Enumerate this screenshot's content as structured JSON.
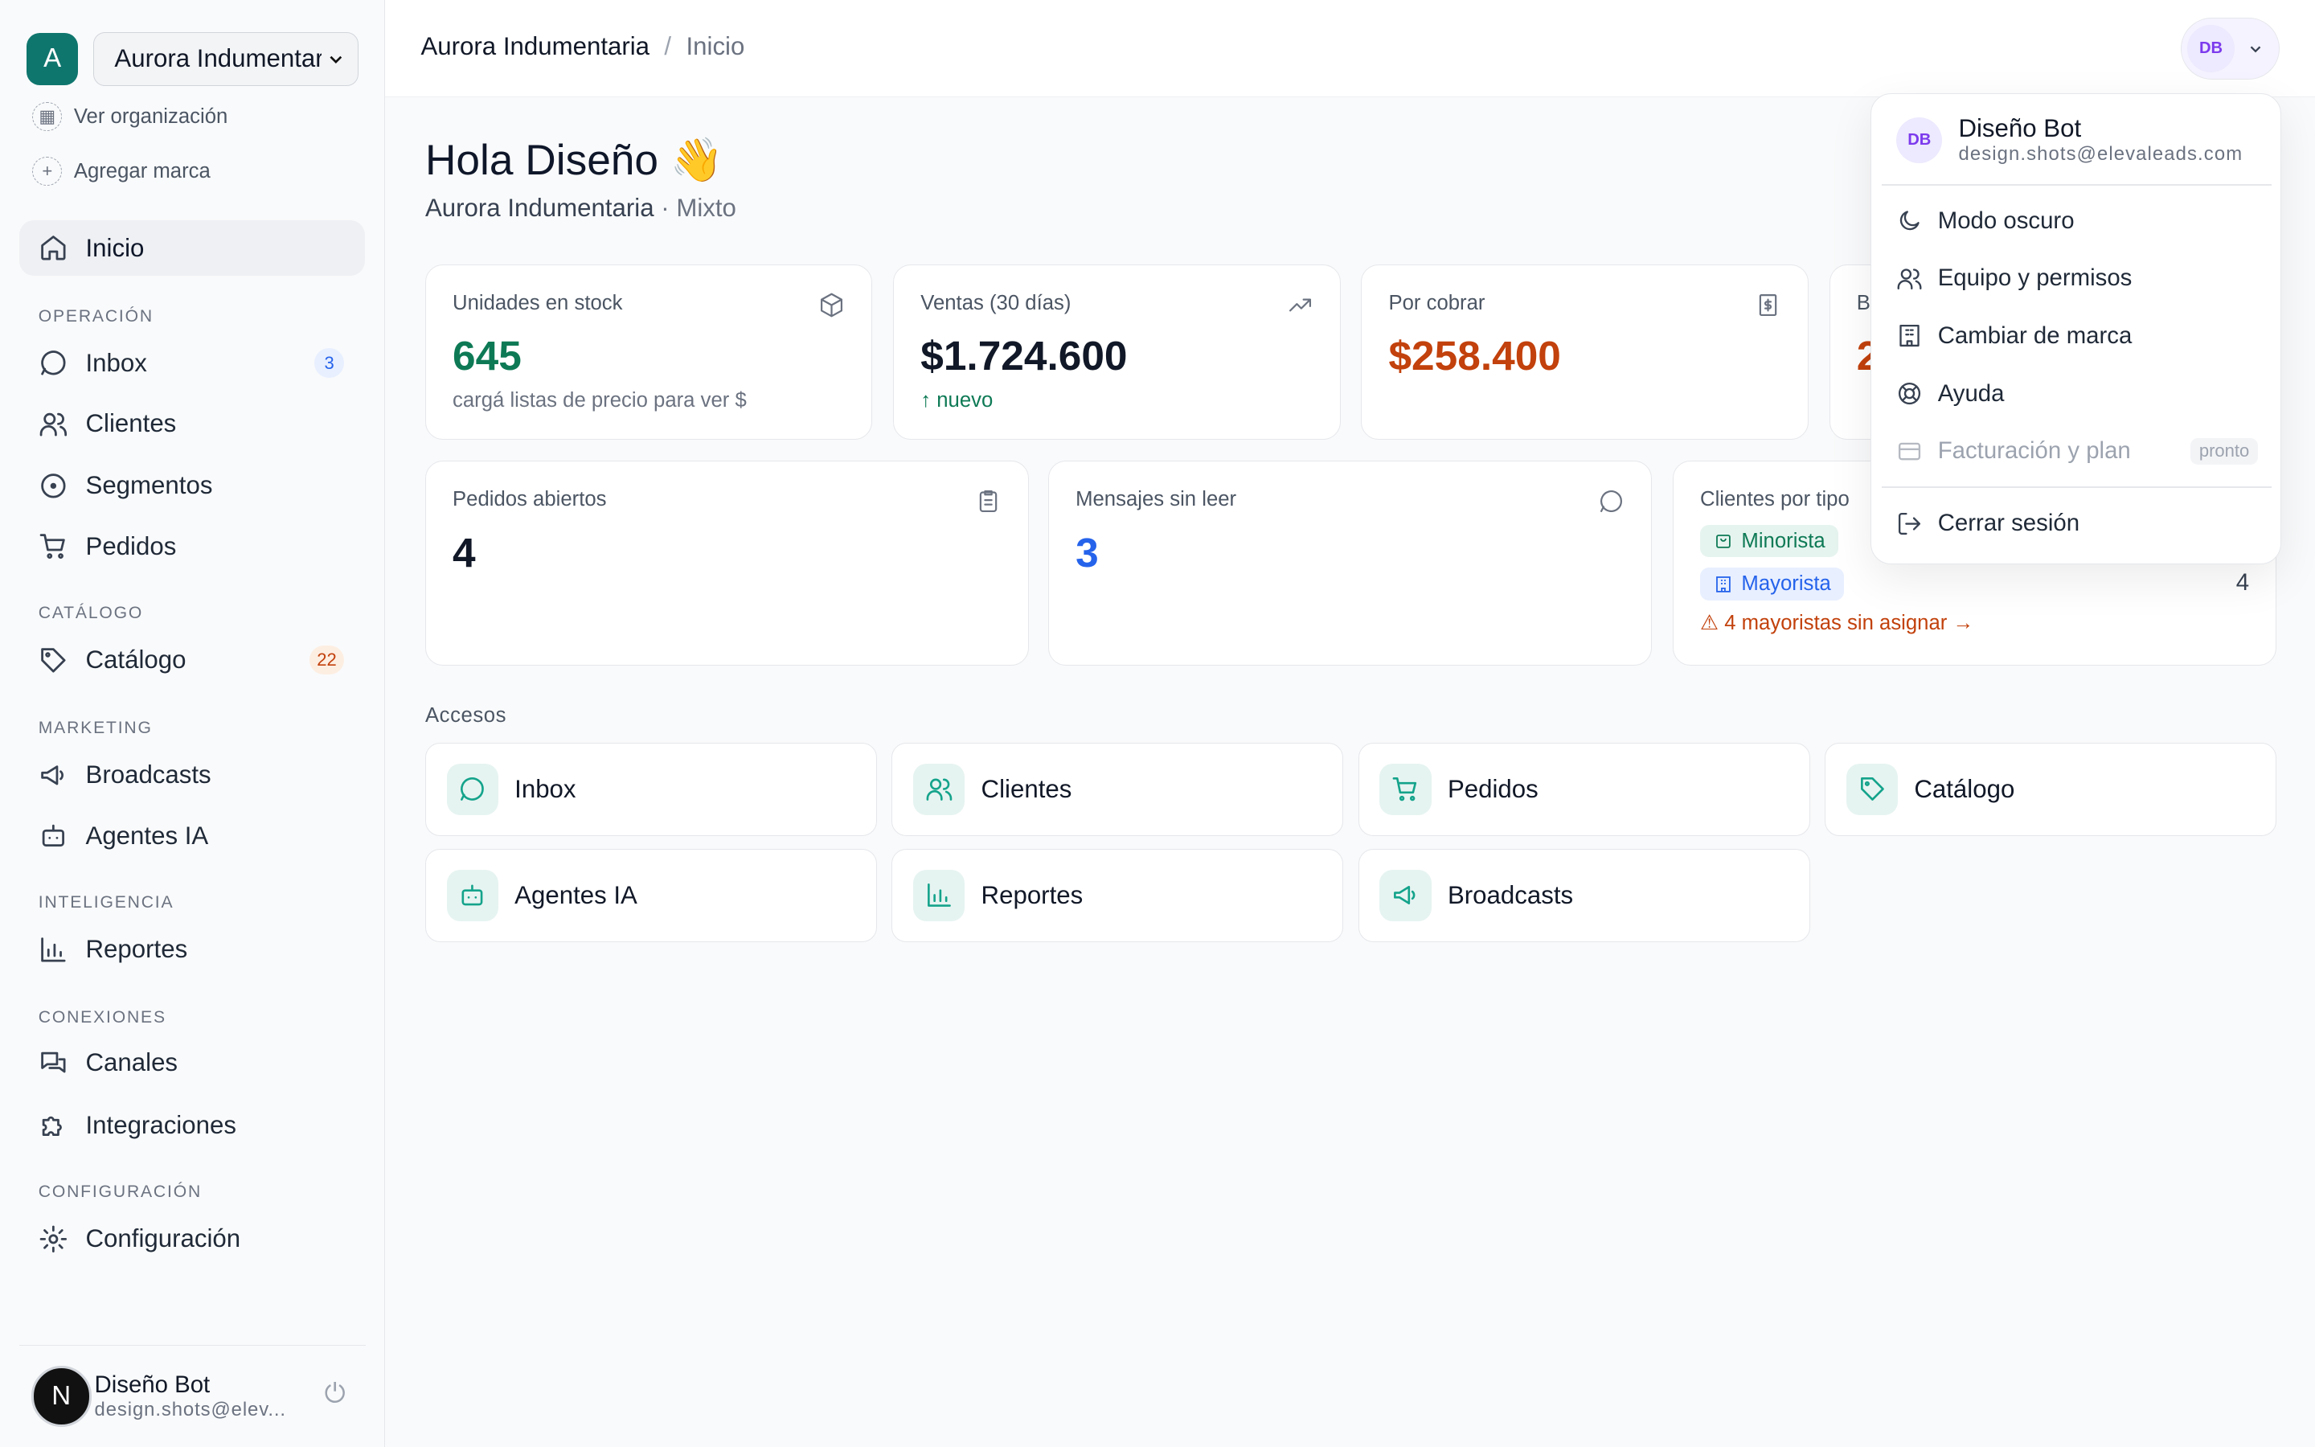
{
  "org": {
    "initial": "A",
    "name": "Aurora Indumentaria",
    "view_link": "Ver organización",
    "add_brand": "Agregar marca"
  },
  "nav": {
    "home": "Inicio",
    "sections": {
      "operacion": "OPERACIÓN",
      "catalogo": "CATÁLOGO",
      "marketing": "MARKETING",
      "inteligencia": "INTELIGENCIA",
      "conexiones": "CONEXIONES",
      "configuracion": "CONFIGURACIÓN"
    },
    "inbox": "Inbox",
    "inbox_badge": "3",
    "clientes": "Clientes",
    "segmentos": "Segmentos",
    "pedidos": "Pedidos",
    "catalogo": "Catálogo",
    "catalogo_badge": "22",
    "broadcasts": "Broadcasts",
    "agentes": "Agentes IA",
    "reportes": "Reportes",
    "canales": "Canales",
    "integraciones": "Integraciones",
    "configuracion": "Configuración"
  },
  "user": {
    "initial": "N",
    "name": "Diseño Bot",
    "email_short": "design.shots@elev...",
    "email": "design.shots@elevaleads.com",
    "avatar_text": "DB"
  },
  "breadcrumb": {
    "org": "Aurora Indumentaria",
    "sep": "/",
    "page": "Inicio"
  },
  "greeting": {
    "title": "Hola Diseño 👋",
    "org": "Aurora Indumentaria",
    "mode": "· Mixto"
  },
  "cards": {
    "stock": {
      "label": "Unidades en stock",
      "value": "645",
      "note": "cargá listas de precio para ver $"
    },
    "sales": {
      "label": "Ventas (30 días)",
      "value": "$1.724.600",
      "note": "↑ nuevo"
    },
    "receivable": {
      "label": "Por cobrar",
      "value": "$258.400"
    },
    "hidden": {
      "label": "B",
      "value": "2"
    },
    "orders": {
      "label": "Pedidos abiertos",
      "value": "4"
    },
    "messages": {
      "label": "Mensajes sin leer",
      "value": "3"
    },
    "client_types": {
      "label": "Clientes por tipo",
      "minorista": "Minorista",
      "mayorista": "Mayorista",
      "mayorista_count": "4",
      "warning": "⚠ 4 mayoristas sin asignar →"
    }
  },
  "access": {
    "label": "Accesos",
    "tiles": [
      "Inbox",
      "Clientes",
      "Pedidos",
      "Catálogo",
      "Agentes IA",
      "Reportes",
      "Broadcasts"
    ]
  },
  "menu": {
    "dark_mode": "Modo oscuro",
    "team": "Equipo y permisos",
    "switch_brand": "Cambiar de marca",
    "help": "Ayuda",
    "billing": "Facturación y plan",
    "billing_badge": "pronto",
    "logout": "Cerrar sesión"
  },
  "colors": {
    "accent": "#0f766e",
    "green": "#0e7a55",
    "orange": "#c2410c",
    "blue": "#2563eb",
    "purple": "#7c3aed"
  }
}
